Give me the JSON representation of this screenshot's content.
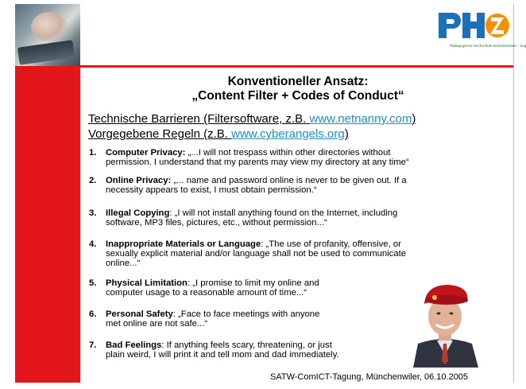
{
  "header": {
    "logo_text": "PH Z",
    "logo_caption": "Pädagogische Hochschule Zentralschweiz · Zug"
  },
  "title": {
    "line1": "Konventioneller Ansatz:",
    "line2": "„Content Filter + Codes of Conduct“"
  },
  "barriers": [
    {
      "prefix": "Technische Barrieren (Filtersoftware, z.B. ",
      "link": "www.netnanny.com",
      "suffix": ")"
    },
    {
      "prefix": "Vorgegebene Regeln (z.B. ",
      "link": "www.cyberangels.org",
      "suffix": ")"
    }
  ],
  "rules": [
    {
      "num": "1.",
      "heading": "Computer Privacy:",
      "lines": [
        "„...I will not trespass within other directories without",
        "permission. I understand that my parents may view my directory at any time“"
      ]
    },
    {
      "num": "2.",
      "heading": "Online Privacy:",
      "lines": [
        "„... name and password online is never to be given out. If a",
        "necessity appears to exist, I must obtain permission.“"
      ]
    },
    {
      "num": "3.",
      "heading": "Illegal Copying",
      "lines": [
        ": „I will not install anything found on the Internet, including",
        "software, MP3 files, pictures, etc., without permission...“"
      ]
    },
    {
      "num": "4.",
      "heading": "Inappropriate Materials or Language",
      "lines": [
        ": „The use of profanity, offensive, or",
        "sexually explicit material and/or language shall not be used to communicate",
        "online...“"
      ]
    },
    {
      "num": "5.",
      "heading": "Physical Limitation",
      "lines": [
        ": „I promise to limit my online and",
        "computer usage to a reasonable amount of time...“"
      ]
    },
    {
      "num": "6.",
      "heading": "Personal Safety",
      "lines": [
        ": „Face to face meetings with anyone",
        "met online are not safe...“"
      ]
    },
    {
      "num": "7.",
      "heading": "Bad Feelings",
      "lines": [
        ": If anything feels scary, threatening, or just",
        "plain weird, I will print it and tell mom and dad immediately."
      ]
    }
  ],
  "footer": "SATW-ComICT-Tagung, Münchenwiler, 06.10.2005",
  "colors": {
    "accent": "#e3161b",
    "link": "#1a8fc8",
    "logo_blue": "#1d6fb8",
    "logo_orange": "#f39200"
  }
}
